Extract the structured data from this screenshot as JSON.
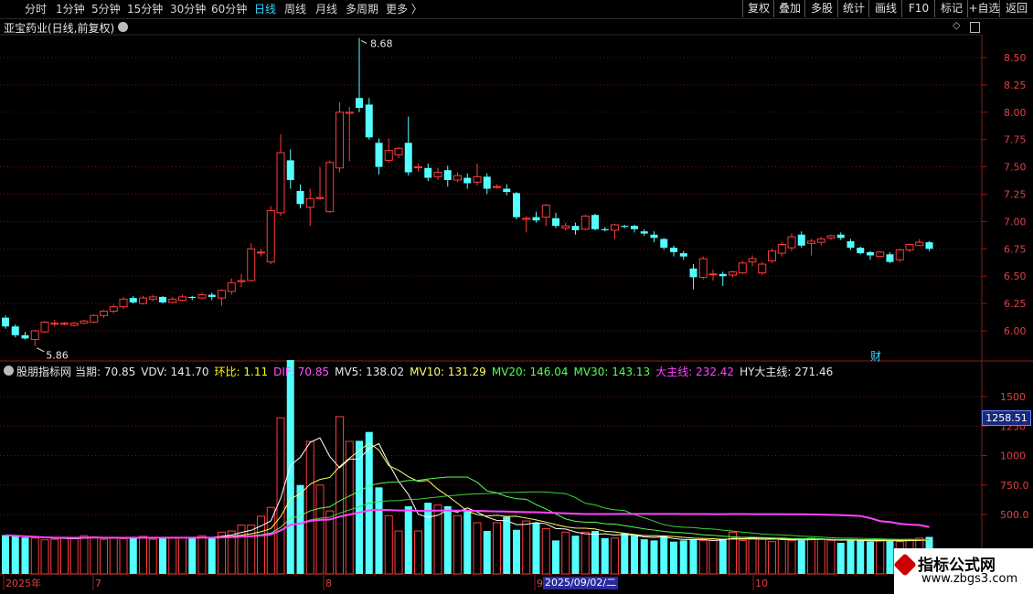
{
  "toolbar": {
    "periods": [
      "分时",
      "1分钟",
      "5分钟",
      "15分钟",
      "30分钟",
      "60分钟",
      "日线",
      "周线",
      "月线",
      "多周期",
      "更多 〉"
    ],
    "active_period": "日线",
    "right_buttons": [
      "复权",
      "叠加",
      "多股",
      "统计",
      "画线",
      "F10",
      "标记",
      "+自选",
      "返回"
    ]
  },
  "price_panel": {
    "title": "亚宝药业(日线,前复权)",
    "high_label": "8.68",
    "low_label": "5.86",
    "fin_marker": "财",
    "y_ticks": [
      "8.50",
      "8.25",
      "8.00",
      "7.75",
      "7.50",
      "7.25",
      "7.00",
      "6.75",
      "6.50",
      "6.25",
      "6.00"
    ]
  },
  "indicator": {
    "name": "股朋指标网",
    "items": [
      {
        "label": "当期:",
        "value": "70.85",
        "color": "#e8e8e8"
      },
      {
        "label": "VDV:",
        "value": "141.70",
        "color": "#e8e8e8"
      },
      {
        "label": "环比:",
        "value": "1.11",
        "color": "#ffff00"
      },
      {
        "label": "DIF:",
        "value": "70.85",
        "color": "#ff55ff"
      },
      {
        "label": "MV5:",
        "value": "138.02",
        "color": "#e8e8e8"
      },
      {
        "label": "MV10:",
        "value": "131.29",
        "color": "#ffff66"
      },
      {
        "label": "MV20:",
        "value": "146.04",
        "color": "#55ff55"
      },
      {
        "label": "MV30:",
        "value": "143.13",
        "color": "#55ff55"
      },
      {
        "label": "大主线:",
        "value": "232.42",
        "color": "#ff44ff"
      },
      {
        "label": "HY大主线:",
        "value": "271.46",
        "color": "#e8e8e8"
      }
    ],
    "y_ticks": [
      "1500",
      "1250",
      "1000",
      "750.0",
      "500.0"
    ],
    "cursor_value": "1258.51"
  },
  "x_axis": {
    "labels": [
      "2025年",
      "7",
      "8",
      "9",
      "10"
    ],
    "cursor_date": "2025/09/02/二"
  },
  "watermark": {
    "title": "指标公式网",
    "url": "www.zbgs3.com"
  },
  "colors": {
    "up": "#ff3a3a",
    "down": "#54ffff",
    "ma_main": "#ff44ff",
    "ma_yellow": "#ffff66",
    "ma_green": "#55ff55",
    "axis": "#8b1a1a",
    "accent": "#3ad6ff"
  },
  "chart_data": [
    {
      "type": "candlestick",
      "title": "亚宝药业(日线,前复权)",
      "ylim": [
        5.75,
        8.8
      ],
      "y_ticks": [
        6.0,
        6.25,
        6.5,
        6.75,
        7.0,
        7.25,
        7.5,
        7.75,
        8.0,
        8.25,
        8.5
      ],
      "annotations": [
        {
          "text": "8.68",
          "value": 8.68
        },
        {
          "text": "5.86",
          "value": 5.86
        }
      ],
      "candles": [
        [
          6.12,
          6.04,
          6.14,
          6.02
        ],
        [
          6.04,
          5.96,
          6.06,
          5.94
        ],
        [
          5.96,
          5.93,
          5.99,
          5.92
        ],
        [
          5.92,
          6.0,
          6.01,
          5.86
        ],
        [
          5.99,
          6.08,
          6.09,
          5.98
        ],
        [
          6.07,
          6.07,
          6.1,
          6.04
        ],
        [
          6.06,
          6.07,
          6.08,
          6.05
        ],
        [
          6.05,
          6.07,
          6.08,
          6.04
        ],
        [
          6.07,
          6.09,
          6.1,
          6.06
        ],
        [
          6.08,
          6.14,
          6.15,
          6.07
        ],
        [
          6.14,
          6.18,
          6.19,
          6.12
        ],
        [
          6.18,
          6.22,
          6.24,
          6.16
        ],
        [
          6.22,
          6.29,
          6.31,
          6.2
        ],
        [
          6.3,
          6.26,
          6.32,
          6.25
        ],
        [
          6.25,
          6.3,
          6.32,
          6.24
        ],
        [
          6.29,
          6.31,
          6.33,
          6.27
        ],
        [
          6.31,
          6.26,
          6.32,
          6.25
        ],
        [
          6.26,
          6.29,
          6.31,
          6.25
        ],
        [
          6.28,
          6.31,
          6.33,
          6.27
        ],
        [
          6.31,
          6.3,
          6.32,
          6.28
        ],
        [
          6.3,
          6.33,
          6.35,
          6.29
        ],
        [
          6.33,
          6.31,
          6.35,
          6.28
        ],
        [
          6.3,
          6.37,
          6.38,
          6.23
        ],
        [
          6.36,
          6.44,
          6.48,
          6.33
        ],
        [
          6.45,
          6.46,
          6.52,
          6.4
        ],
        [
          6.46,
          6.75,
          6.8,
          6.45
        ],
        [
          6.72,
          6.72,
          6.75,
          6.68
        ],
        [
          6.63,
          7.1,
          7.14,
          6.61
        ],
        [
          7.08,
          7.63,
          7.8,
          7.05
        ],
        [
          7.56,
          7.38,
          7.66,
          7.3
        ],
        [
          7.28,
          7.16,
          7.34,
          7.12
        ],
        [
          7.13,
          7.21,
          7.3,
          6.96
        ],
        [
          7.21,
          7.22,
          7.5,
          7.2
        ],
        [
          7.09,
          7.54,
          7.56,
          7.08
        ],
        [
          7.49,
          8.0,
          8.09,
          7.45
        ],
        [
          7.99,
          8.0,
          8.05,
          7.55
        ],
        [
          8.13,
          8.04,
          8.68,
          8.0
        ],
        [
          8.07,
          7.77,
          8.13,
          7.75
        ],
        [
          7.72,
          7.5,
          7.76,
          7.43
        ],
        [
          7.56,
          7.65,
          7.76,
          7.54
        ],
        [
          7.61,
          7.67,
          7.68,
          7.58
        ],
        [
          7.72,
          7.45,
          7.96,
          7.42
        ],
        [
          7.5,
          7.5,
          7.53,
          7.46
        ],
        [
          7.49,
          7.4,
          7.53,
          7.37
        ],
        [
          7.41,
          7.45,
          7.49,
          7.38
        ],
        [
          7.47,
          7.38,
          7.51,
          7.32
        ],
        [
          7.38,
          7.42,
          7.45,
          7.36
        ],
        [
          7.4,
          7.35,
          7.44,
          7.3
        ],
        [
          7.36,
          7.41,
          7.53,
          7.33
        ],
        [
          7.41,
          7.3,
          7.44,
          7.25
        ],
        [
          7.32,
          7.32,
          7.34,
          7.3
        ],
        [
          7.3,
          7.27,
          7.34,
          7.24
        ],
        [
          7.26,
          7.04,
          7.27,
          7.02
        ],
        [
          7.02,
          7.03,
          7.05,
          6.9
        ],
        [
          7.04,
          7.01,
          7.09,
          6.99
        ],
        [
          7.04,
          7.15,
          7.16,
          6.96
        ],
        [
          7.03,
          6.96,
          7.08,
          6.94
        ],
        [
          6.94,
          6.96,
          6.99,
          6.92
        ],
        [
          6.96,
          6.92,
          6.99,
          6.88
        ],
        [
          6.93,
          7.05,
          7.06,
          6.92
        ],
        [
          7.06,
          6.93,
          7.07,
          6.92
        ],
        [
          6.93,
          6.92,
          6.95,
          6.91
        ],
        [
          6.92,
          6.97,
          6.98,
          6.84
        ],
        [
          6.96,
          6.95,
          6.97,
          6.94
        ],
        [
          6.96,
          6.93,
          6.97,
          6.9
        ],
        [
          6.91,
          6.89,
          6.93,
          6.87
        ],
        [
          6.88,
          6.85,
          6.91,
          6.81
        ],
        [
          6.84,
          6.76,
          6.85,
          6.74
        ],
        [
          6.76,
          6.72,
          6.78,
          6.68
        ],
        [
          6.71,
          6.68,
          6.73,
          6.65
        ],
        [
          6.57,
          6.49,
          6.61,
          6.38
        ],
        [
          6.49,
          6.66,
          6.68,
          6.47
        ],
        [
          6.52,
          6.52,
          6.56,
          6.46
        ],
        [
          6.52,
          6.5,
          6.54,
          6.41
        ],
        [
          6.51,
          6.54,
          6.55,
          6.49
        ],
        [
          6.53,
          6.62,
          6.64,
          6.52
        ],
        [
          6.63,
          6.66,
          6.69,
          6.59
        ],
        [
          6.53,
          6.61,
          6.63,
          6.51
        ],
        [
          6.64,
          6.73,
          6.75,
          6.62
        ],
        [
          6.71,
          6.79,
          6.81,
          6.68
        ],
        [
          6.76,
          6.86,
          6.89,
          6.73
        ],
        [
          6.88,
          6.78,
          6.91,
          6.76
        ],
        [
          6.8,
          6.82,
          6.84,
          6.69
        ],
        [
          6.81,
          6.84,
          6.86,
          6.78
        ],
        [
          6.85,
          6.87,
          6.88,
          6.83
        ],
        [
          6.88,
          6.85,
          6.9,
          6.83
        ],
        [
          6.82,
          6.76,
          6.84,
          6.74
        ],
        [
          6.76,
          6.71,
          6.77,
          6.7
        ],
        [
          6.72,
          6.69,
          6.73,
          6.65
        ],
        [
          6.68,
          6.72,
          6.73,
          6.67
        ],
        [
          6.7,
          6.63,
          6.72,
          6.62
        ],
        [
          6.65,
          6.74,
          6.75,
          6.63
        ],
        [
          6.74,
          6.79,
          6.8,
          6.72
        ],
        [
          6.78,
          6.81,
          6.84,
          6.78
        ],
        [
          6.81,
          6.75,
          6.82,
          6.73
        ]
      ]
    },
    {
      "type": "bar",
      "title": "股朋指标网",
      "ylim": [
        200,
        1810
      ],
      "y_ticks": [
        500,
        750,
        1000,
        1250,
        1500
      ],
      "values": [
        325,
        315,
        305,
        300,
        285,
        290,
        305,
        295,
        320,
        310,
        290,
        300,
        295,
        305,
        315,
        290,
        310,
        300,
        305,
        300,
        320,
        300,
        350,
        360,
        410,
        410,
        485,
        560,
        1320,
        1810,
        750,
        1120,
        750,
        530,
        1330,
        1120,
        1125,
        1200,
        730,
        490,
        360,
        570,
        360,
        600,
        580,
        570,
        490,
        540,
        430,
        360,
        430,
        480,
        370,
        445,
        430,
        380,
        280,
        350,
        320,
        350,
        360,
        300,
        300,
        340,
        320,
        290,
        280,
        320,
        270,
        280,
        290,
        280,
        280,
        290,
        350,
        280,
        295,
        290,
        270,
        300,
        280,
        280,
        300,
        290,
        280,
        260,
        290,
        280,
        270,
        280,
        280,
        270,
        290,
        300,
        310
      ]
    }
  ]
}
